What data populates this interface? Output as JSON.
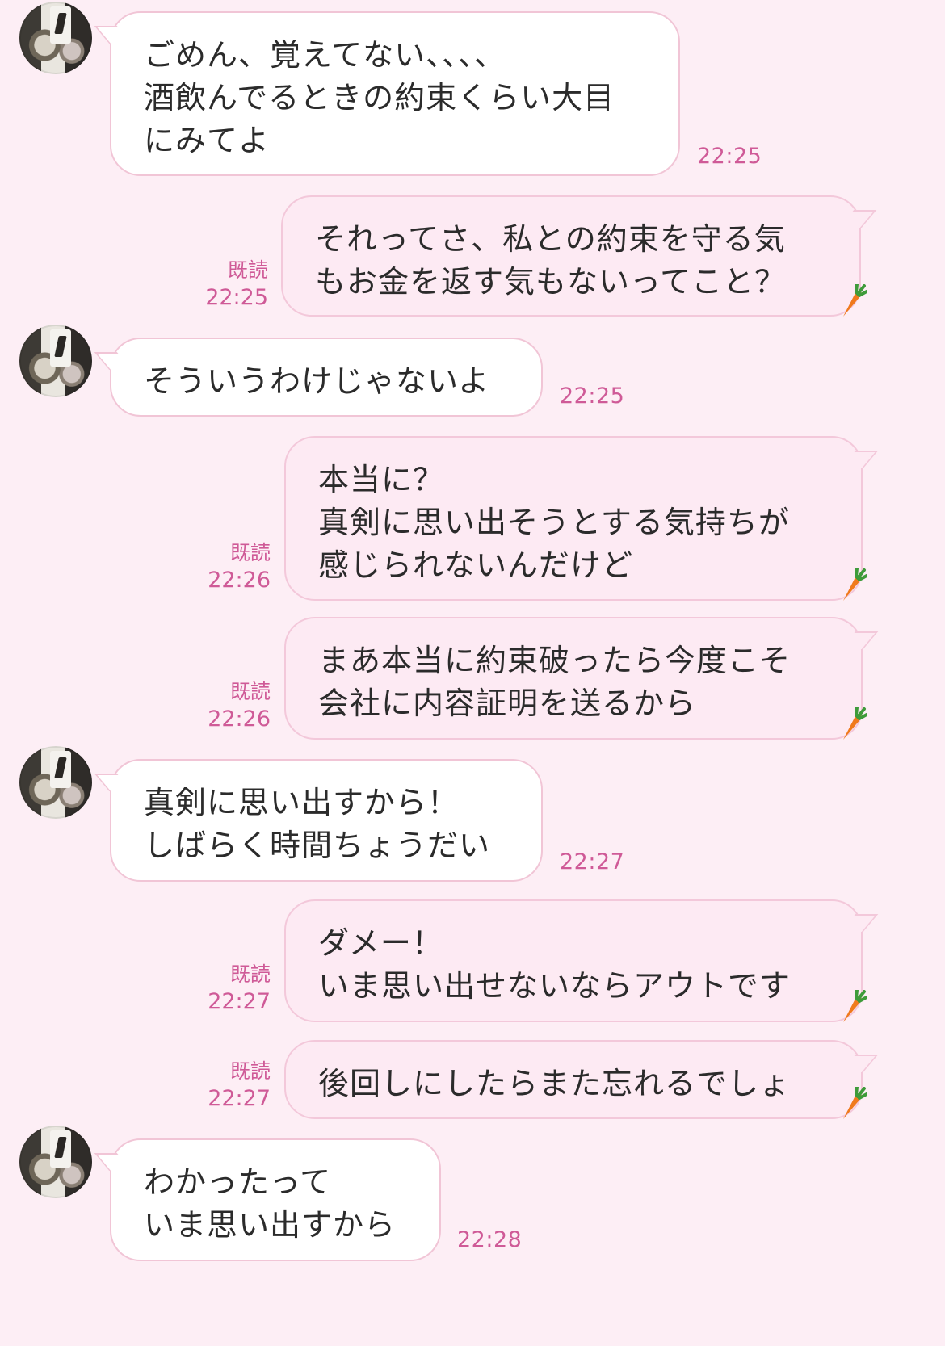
{
  "colors": {
    "background": "#fdeef5",
    "incoming_bubble": "#ffffff",
    "outgoing_bubble": "#fdeaf3",
    "bubble_border": "#f1c5d6",
    "meta_text": "#cf5a97"
  },
  "read_label": "既読",
  "messages": [
    {
      "side": "in",
      "text": "ごめん、覚えてない、、、、\n酒飲んでるときの約束くらい大目\nにみてよ",
      "time": "22:25"
    },
    {
      "side": "out",
      "text": "それってさ、私との約束を守る気\nもお金を返す気もないってこと？",
      "time": "22:25",
      "read": "既読"
    },
    {
      "side": "in",
      "text": "そういうわけじゃないよ",
      "time": "22:25"
    },
    {
      "side": "out",
      "text": "本当に？\n真剣に思い出そうとする気持ちが\n感じられないんだけど",
      "time": "22:26",
      "read": "既読"
    },
    {
      "side": "out",
      "text": "まあ本当に約束破ったら今度こそ\n会社に内容証明を送るから",
      "time": "22:26",
      "read": "既読"
    },
    {
      "side": "in",
      "text": "真剣に思い出すから！\nしばらく時間ちょうだい",
      "time": "22:27"
    },
    {
      "side": "out",
      "text": "ダメー！\nいま思い出せないならアウトです",
      "time": "22:27",
      "read": "既読"
    },
    {
      "side": "out",
      "text": "後回しにしたらまた忘れるでしょ",
      "time": "22:27",
      "read": "既読"
    },
    {
      "side": "in",
      "text": "わかったって\nいま思い出すから",
      "time": "22:28"
    }
  ]
}
